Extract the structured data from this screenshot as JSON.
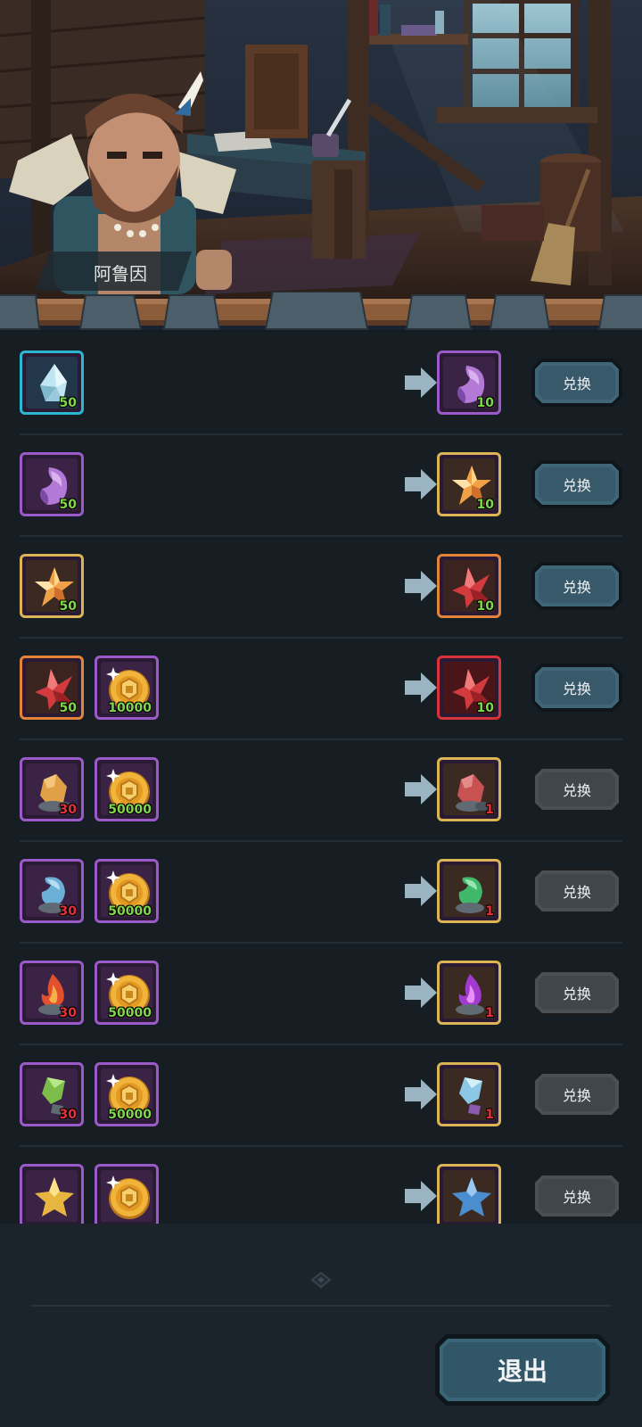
{
  "npc": {
    "name": "阿鲁因"
  },
  "exchange_label": "兑换",
  "exit_label": "退出",
  "rows": [
    {
      "inputs": [
        {
          "icon": "blue-crystal-icon",
          "count": "50",
          "count_color": "#7fd84a",
          "quality": "blue"
        }
      ],
      "output": {
        "icon": "purple-gem-icon",
        "count": "10",
        "count_color": "#7fd84a",
        "quality": "purple"
      },
      "enabled": true
    },
    {
      "inputs": [
        {
          "icon": "purple-gem-icon",
          "count": "50",
          "count_color": "#7fd84a",
          "quality": "purple"
        }
      ],
      "output": {
        "icon": "gold-star-crystal-icon",
        "count": "10",
        "count_color": "#7fd84a",
        "quality": "gold"
      },
      "enabled": true
    },
    {
      "inputs": [
        {
          "icon": "gold-star-crystal-icon",
          "count": "50",
          "count_color": "#7fd84a",
          "quality": "gold"
        }
      ],
      "output": {
        "icon": "red-crystal-icon",
        "count": "10",
        "count_color": "#7fd84a",
        "quality": "orange"
      },
      "enabled": true
    },
    {
      "inputs": [
        {
          "icon": "red-crystal-icon",
          "count": "50",
          "count_color": "#7fd84a",
          "quality": "orange"
        },
        {
          "icon": "gold-coin-icon",
          "count": "10000",
          "count_color": "#7fd84a",
          "quality": "purple"
        }
      ],
      "output": {
        "icon": "red-crystal-icon",
        "count": "10",
        "count_color": "#7fd84a",
        "quality": "red"
      },
      "enabled": true
    },
    {
      "inputs": [
        {
          "icon": "amber-ore-icon",
          "count": "30",
          "count_color": "#e2333a",
          "quality": "purple"
        },
        {
          "icon": "gold-coin-icon",
          "count": "50000",
          "count_color": "#7fd84a",
          "quality": "purple"
        }
      ],
      "output": {
        "icon": "red-ore-icon",
        "count": "1",
        "count_color": "#e2333a",
        "quality": "gold"
      },
      "enabled": false
    },
    {
      "inputs": [
        {
          "icon": "blue-ore-icon",
          "count": "30",
          "count_color": "#e2333a",
          "quality": "purple"
        },
        {
          "icon": "gold-coin-icon",
          "count": "50000",
          "count_color": "#7fd84a",
          "quality": "purple"
        }
      ],
      "output": {
        "icon": "green-ore-icon",
        "count": "1",
        "count_color": "#e2333a",
        "quality": "gold"
      },
      "enabled": false
    },
    {
      "inputs": [
        {
          "icon": "fire-ore-icon",
          "count": "30",
          "count_color": "#e2333a",
          "quality": "purple"
        },
        {
          "icon": "gold-coin-icon",
          "count": "50000",
          "count_color": "#7fd84a",
          "quality": "purple"
        }
      ],
      "output": {
        "icon": "purple-fire-ore-icon",
        "count": "1",
        "count_color": "#e2333a",
        "quality": "gold"
      },
      "enabled": false
    },
    {
      "inputs": [
        {
          "icon": "green-shard-icon",
          "count": "30",
          "count_color": "#e2333a",
          "quality": "purple"
        },
        {
          "icon": "gold-coin-icon",
          "count": "50000",
          "count_color": "#7fd84a",
          "quality": "purple"
        }
      ],
      "output": {
        "icon": "ice-shard-icon",
        "count": "1",
        "count_color": "#e2333a",
        "quality": "gold"
      },
      "enabled": false
    },
    {
      "inputs": [
        {
          "icon": "gold-star-icon",
          "count": "",
          "count_color": "#e2333a",
          "quality": "purple"
        },
        {
          "icon": "gold-coin-icon",
          "count": "",
          "count_color": "#7fd84a",
          "quality": "purple"
        }
      ],
      "output": {
        "icon": "blue-star-icon",
        "count": "",
        "count_color": "#e2333a",
        "quality": "gold"
      },
      "enabled": false
    }
  ]
}
